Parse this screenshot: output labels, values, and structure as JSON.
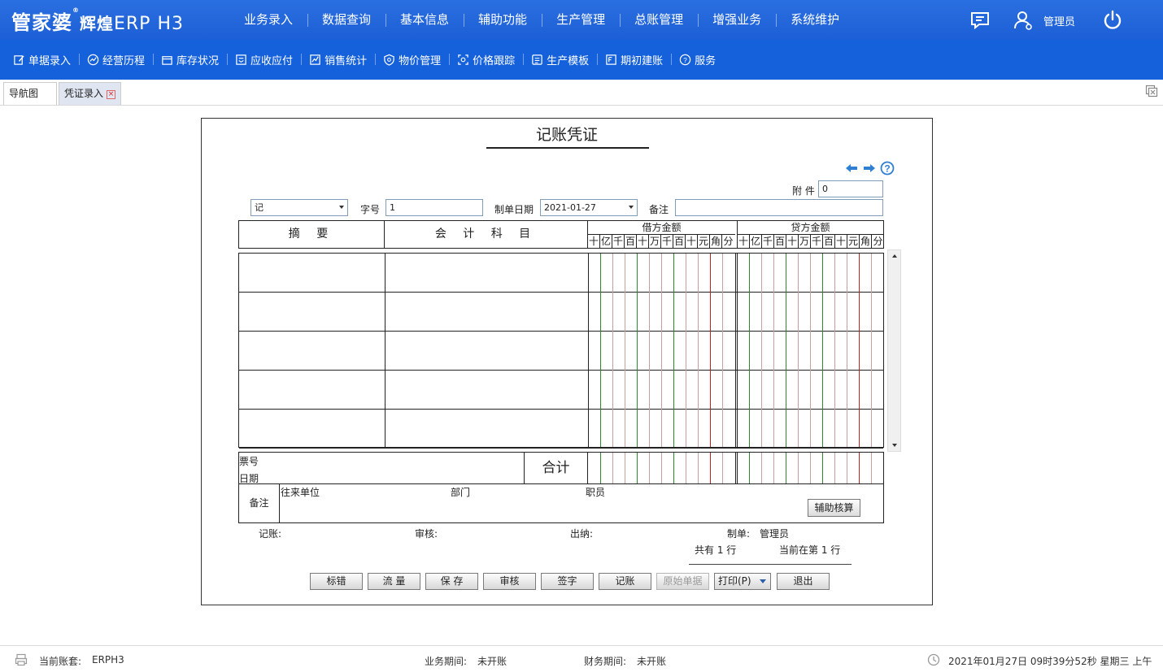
{
  "app": {
    "logo_main": "管家婆",
    "logo_sup": "®",
    "logo_sub": "辉煌",
    "logo_erp": "ERP H3"
  },
  "main_nav": [
    "业务录入",
    "数据查询",
    "基本信息",
    "辅助功能",
    "生产管理",
    "总账管理",
    "增强业务",
    "系统维护"
  ],
  "user": {
    "name": "管理员"
  },
  "toolbar": [
    "单据录入",
    "经营历程",
    "库存状况",
    "应收应付",
    "销售统计",
    "物价管理",
    "价格跟踪",
    "生产模板",
    "期初建账",
    "服务"
  ],
  "tabs": [
    {
      "label": "导航图"
    },
    {
      "label": "凭证录入"
    }
  ],
  "voucher": {
    "title": "记账凭证",
    "attachment_label": "附 件",
    "attachment_value": "0",
    "type_value": "记",
    "number_label": "字号",
    "number_value": "1",
    "date_label": "制单日期",
    "date_value": "2021-01-27",
    "remark_label": "备注",
    "remark_value": "",
    "col_summary": "摘 要",
    "col_account": "会 计 科 目",
    "debit_label": "借方金额",
    "credit_label": "贷方金额",
    "units": [
      "十",
      "亿",
      "千",
      "百",
      "十",
      "万",
      "千",
      "百",
      "十",
      "元",
      "角",
      "分"
    ],
    "ticket_label": "票号",
    "date2_label": "日期",
    "total_label": "合计",
    "note_label": "备注",
    "partner_label": "往来单位",
    "dept_label": "部门",
    "staff_label": "职员",
    "aux_button": "辅助核算",
    "bookkeeper_label": "记账:",
    "auditor_label": "审核:",
    "cashier_label": "出纳:",
    "maker_label": "制单:",
    "maker_value": "管理员",
    "total_rows_text": "共有 1 行",
    "current_row_text": "当前在第 1 行"
  },
  "actions": [
    "标错",
    "流 量",
    "保 存",
    "审核",
    "签字",
    "记账",
    "原始单据",
    "打印(P)",
    "退出"
  ],
  "status": {
    "account_label": "当前账套:",
    "account_value": "ERPH3",
    "biz_period_label": "业务期间:",
    "biz_period_value": "未开账",
    "fin_period_label": "财务期间:",
    "fin_period_value": "未开账",
    "datetime": "2021年01月27日 09时39分52秒 星期三 上午"
  }
}
